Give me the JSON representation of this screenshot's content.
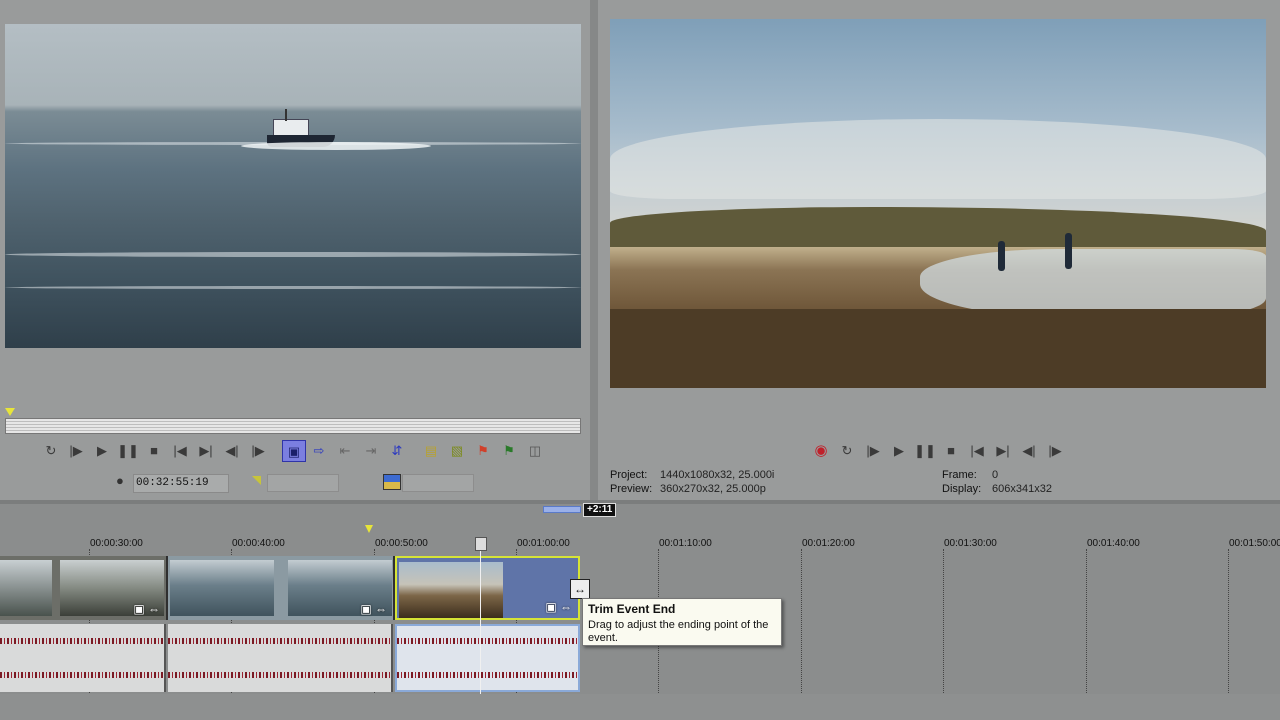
{
  "trimmer": {
    "timecode": "00:32:55:19"
  },
  "preview": {
    "project_label": "Project:",
    "project_value": "1440x1080x32, 25.000i",
    "preview_label": "Preview:",
    "preview_value": "360x270x32, 25.000p",
    "frame_label": "Frame:",
    "frame_value": "0",
    "display_label": "Display:",
    "display_value": "606x341x32"
  },
  "timeline": {
    "selection_length": "+2:11",
    "ruler_ticks": [
      "00:00:30:00",
      "00:00:40:00",
      "00:00:50:00",
      "00:01:00:00",
      "00:01:10:00",
      "00:01:20:00",
      "00:01:30:00",
      "00:01:40:00",
      "00:01:50:00"
    ]
  },
  "tooltip": {
    "title": "Trim Event End",
    "body": "Drag to adjust the ending point of the event."
  },
  "colors": {
    "selection_outline": "#d6e436",
    "audio_waveform": "#7a1a24",
    "record": "#c0202a",
    "active_button": "#7b7fe0"
  }
}
